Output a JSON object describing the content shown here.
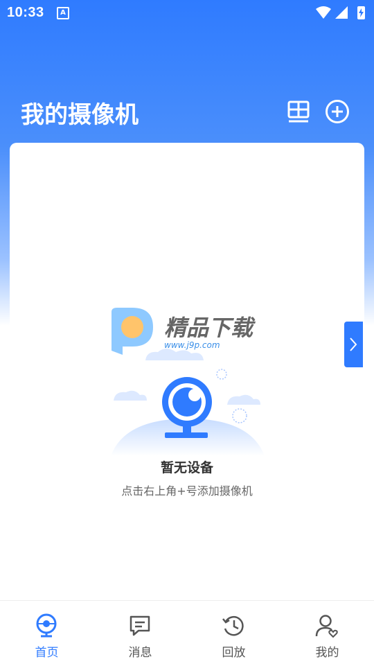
{
  "status_bar": {
    "time": "10:33",
    "notification_icon": "A"
  },
  "header": {
    "title": "我的摄像机",
    "layout_icon": "grid-layout-icon",
    "add_icon": "plus-circle-icon"
  },
  "watermark": {
    "brand": "精品下载",
    "url": "www.j9p.com"
  },
  "empty_state": {
    "title": "暂无设备",
    "subtitle": "点击右上角+号添加摄像机"
  },
  "tabs": [
    {
      "label": "首页",
      "icon": "camera-icon",
      "active": true
    },
    {
      "label": "消息",
      "icon": "message-icon",
      "active": false
    },
    {
      "label": "回放",
      "icon": "history-icon",
      "active": false
    },
    {
      "label": "我的",
      "icon": "profile-icon",
      "active": false
    }
  ],
  "colors": {
    "accent": "#2f7bff",
    "tab_inactive": "#555555"
  }
}
